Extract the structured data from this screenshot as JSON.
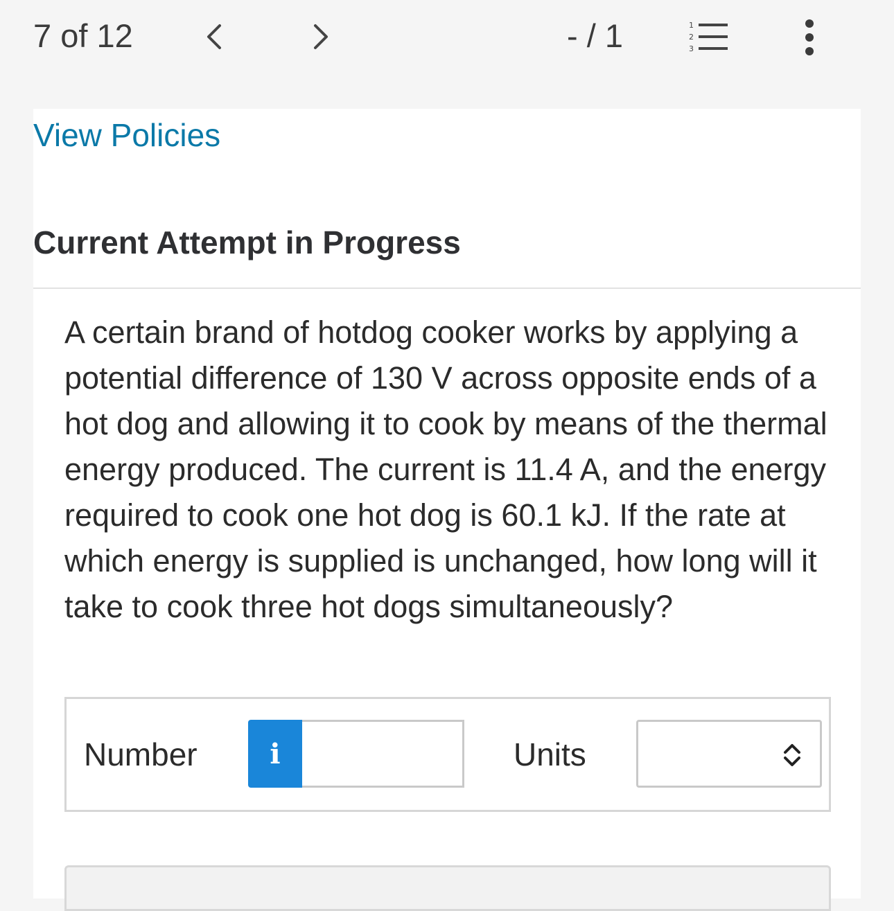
{
  "topbar": {
    "counter": "7 of 12",
    "score": "- / 1"
  },
  "card": {
    "policies_link": "View Policies",
    "attempt_title": "Current Attempt in Progress",
    "question": "A certain brand of hotdog cooker works by applying a potential difference of 130 V across opposite ends of a hot dog and allowing it to cook by means of the thermal energy produced. The current is 11.4 A, and the energy required to cook one hot dog is 60.1 kJ. If the rate at which energy is supplied is unchanged, how long will it take to cook three hot dogs simultaneously?"
  },
  "answer": {
    "number_label": "Number",
    "info_glyph": "i",
    "number_value": "",
    "units_label": "Units",
    "units_selected": ""
  },
  "icons": {
    "prev": "chevron-left-icon",
    "next": "chevron-right-icon",
    "list": "numbered-list-icon",
    "more": "more-vertical-icon",
    "info": "info-icon",
    "select": "up-down-chevron-icon"
  },
  "colors": {
    "link": "#0b79a8",
    "info_button": "#1a86d9",
    "background": "#f5f5f5"
  }
}
